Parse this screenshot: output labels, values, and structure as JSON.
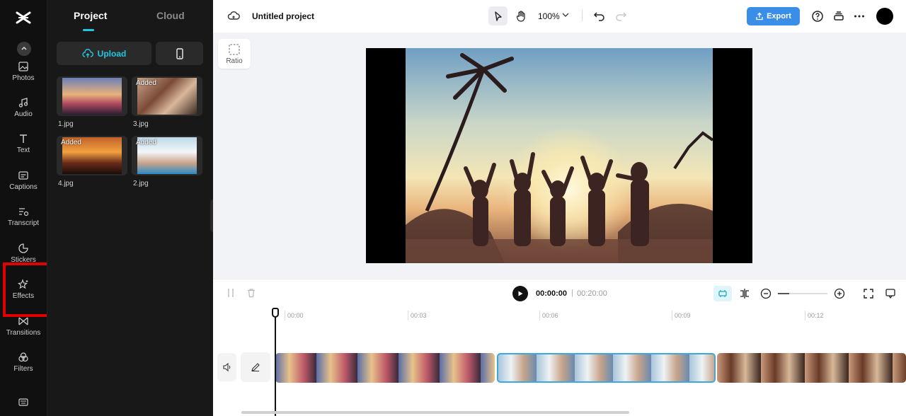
{
  "rail": {
    "items": [
      {
        "label": "Photos",
        "icon": "image-icon"
      },
      {
        "label": "Audio",
        "icon": "music-icon"
      },
      {
        "label": "Text",
        "icon": "text-icon"
      },
      {
        "label": "Captions",
        "icon": "captions-icon"
      },
      {
        "label": "Transcript",
        "icon": "transcript-icon"
      },
      {
        "label": "Stickers",
        "icon": "sticker-icon"
      },
      {
        "label": "Effects",
        "icon": "effects-icon"
      },
      {
        "label": "Transitions",
        "icon": "transitions-icon"
      },
      {
        "label": "Filters",
        "icon": "filters-icon"
      }
    ],
    "highlight_color": "#e00000"
  },
  "panel": {
    "tabs": [
      {
        "label": "Project"
      },
      {
        "label": "Cloud"
      }
    ],
    "upload_label": "Upload",
    "media": [
      {
        "name": "1.jpg",
        "badge": ""
      },
      {
        "name": "3.jpg",
        "badge": "Added"
      },
      {
        "name": "4.jpg",
        "badge": "Added"
      },
      {
        "name": "2.jpg",
        "badge": "Added"
      }
    ]
  },
  "topbar": {
    "project_title": "Untitled project",
    "zoom": "100%",
    "export_label": "Export",
    "accent": "#3b8ee8"
  },
  "stage": {
    "ratio_label": "Ratio"
  },
  "timeline": {
    "current_time": "00:00:00",
    "separator": "|",
    "total_time": "00:20:00",
    "ruler": [
      "00:00",
      "00:03",
      "00:06",
      "00:09",
      "00:12"
    ]
  }
}
